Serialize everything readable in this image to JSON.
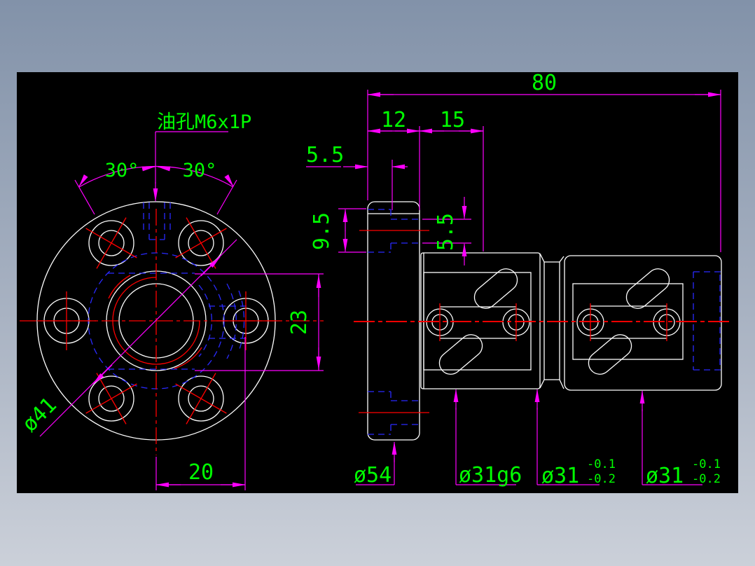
{
  "window": {
    "frame_top_color": "#8292a9",
    "frame_bottom_color": "#cbd0d9",
    "canvas_background": "#000000"
  },
  "palette": {
    "outline": "#ffffff",
    "dimension_lines": "#ff00ff",
    "label_text": "#00ff00",
    "hidden_lines": "#2a2aff",
    "center_lines": "#ff0000"
  },
  "front_view": {
    "oil_hole_label": "油孔M6x1P",
    "angle_left": "30°",
    "angle_right": "30°",
    "bolt_circle_dia": "ø41",
    "center_offset": "20",
    "flat_width": "23"
  },
  "side_view": {
    "overall_length": "80",
    "flange_thickness": "12",
    "neck_length": "15",
    "counterbore_depth": "5.5",
    "counterbore_dia": "9.5",
    "bolt_hole_dia": "5.5",
    "flange_dia": "ø54",
    "body_dia": "ø31g6",
    "mid_dia": "ø31",
    "mid_tol_upper": "-0.1",
    "mid_tol_lower": "-0.2",
    "end_dia": "ø31",
    "end_tol_upper": "-0.1",
    "end_tol_lower": "-0.2"
  }
}
